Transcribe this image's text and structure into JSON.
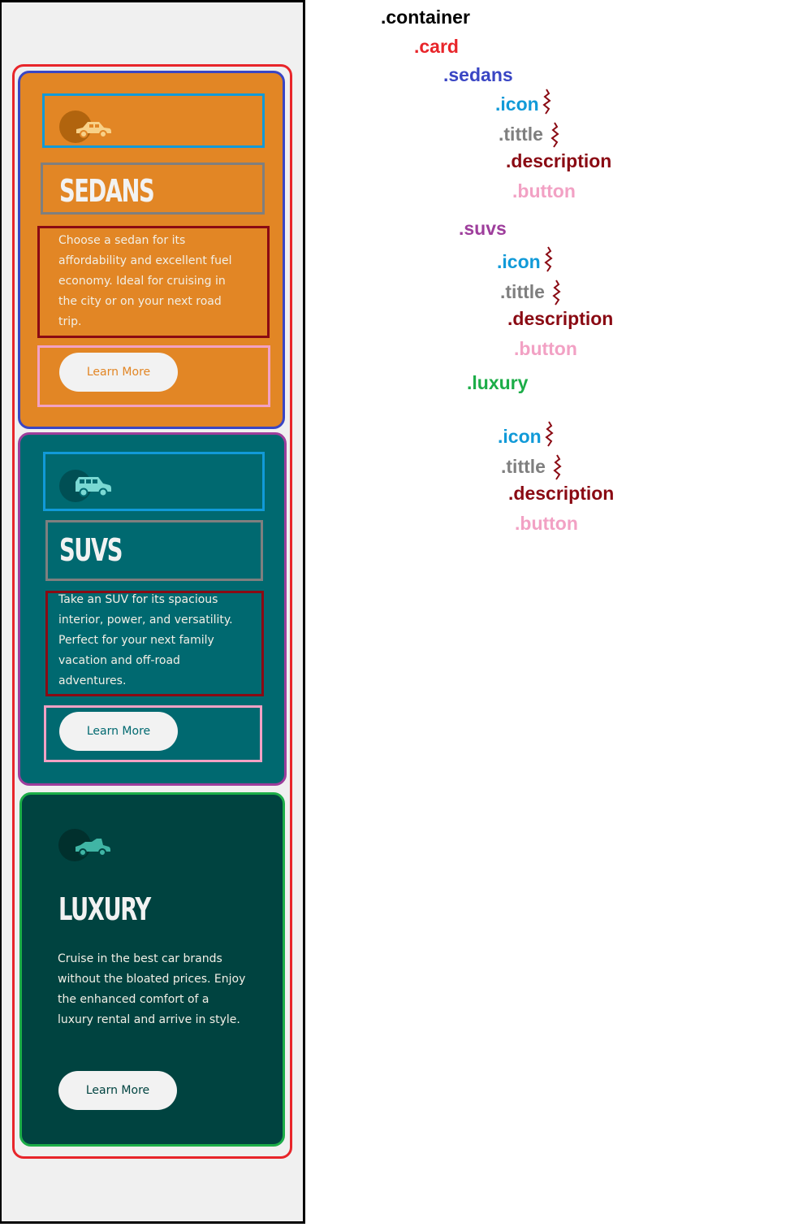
{
  "colors": {
    "sedans_bg": "#e28625",
    "suvs_bg": "#006970",
    "luxury_bg": "#004340",
    "card_outline": "#e8252a",
    "sedans_outline": "#3a46c4",
    "suvs_outline": "#9e3e9c",
    "luxury_outline": "#1cad48",
    "icon_outline": "#119ad8",
    "title_outline": "#7f7f7f",
    "description_outline": "#8a0a13",
    "button_outline": "#f2a1c4"
  },
  "cards": {
    "sedans": {
      "icon": "sedan-car-icon",
      "title": "SEDANS",
      "description": "Choose a sedan for its affordability and excellent fuel economy. Ideal for cruising in the city or on your next road trip.",
      "button": "Learn More"
    },
    "suvs": {
      "icon": "suv-car-icon",
      "title": "SUVS",
      "description": "Take an SUV for its spacious interior, power, and versatility. Perfect for your next family vacation and off-road adventures.",
      "button": "Learn More"
    },
    "luxury": {
      "icon": "luxury-car-icon",
      "title": "LUXURY",
      "description": "Cruise in the best car brands without the bloated prices. Enjoy the enhanced comfort of a luxury rental and arrive in style.",
      "button": "Learn More"
    }
  },
  "labels": {
    "container": ".container",
    "card": ".card",
    "sedans": ".sedans",
    "suvs": ".suvs",
    "luxury": ".luxury",
    "icon": ".icon",
    "title": ".tittle",
    "description": ".description",
    "button": ".button"
  }
}
